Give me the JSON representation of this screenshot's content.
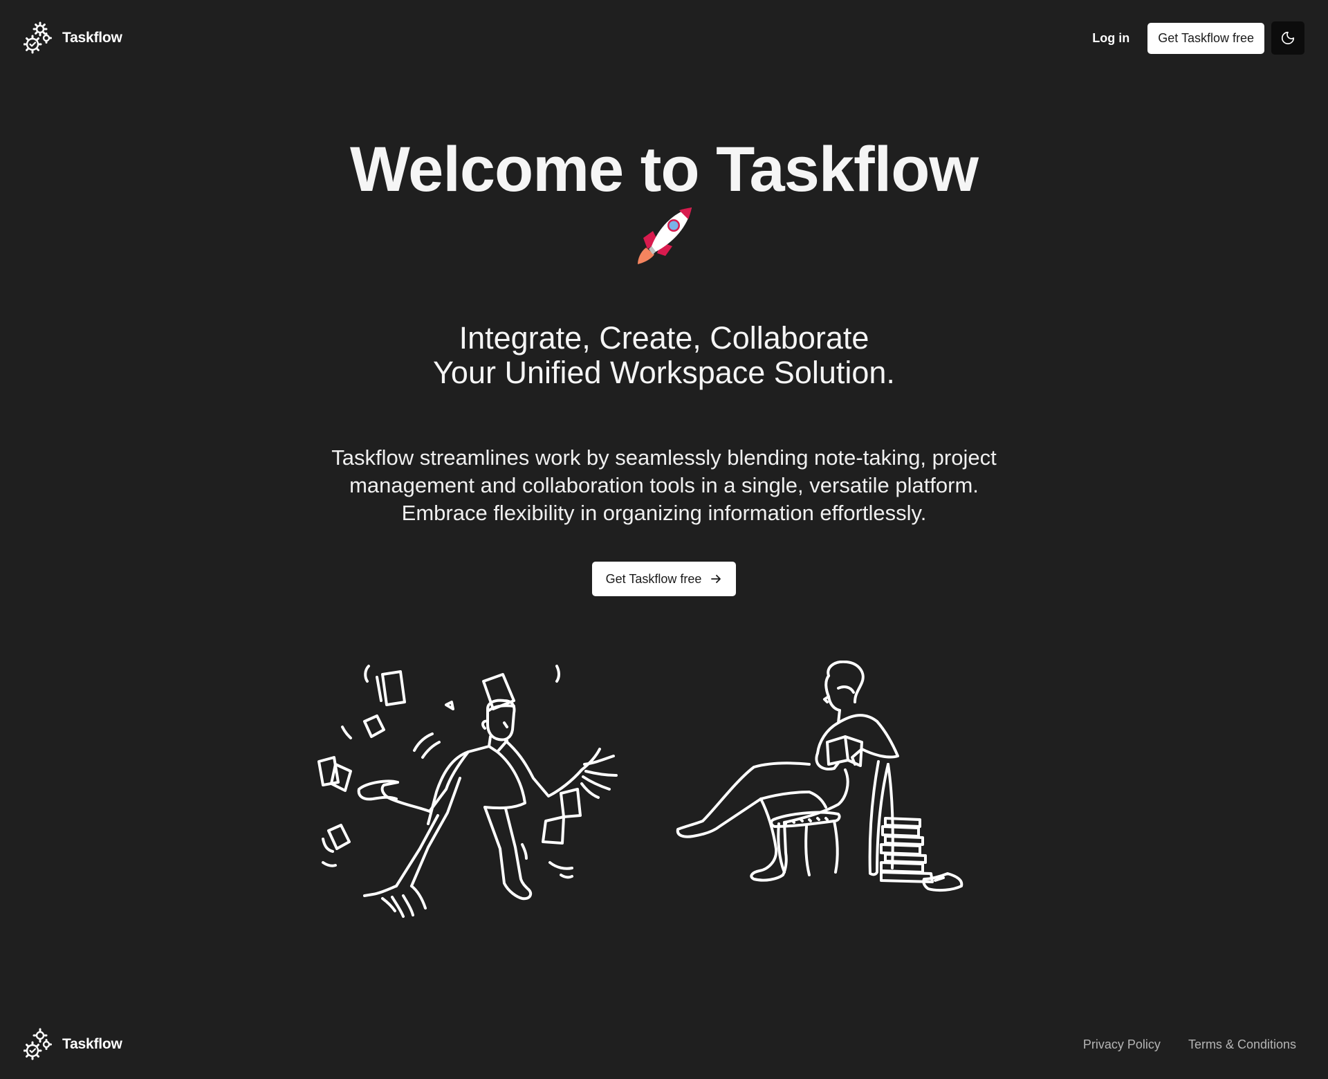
{
  "brand": {
    "name": "Taskflow",
    "logo_icon": "gears-check-icon"
  },
  "header": {
    "login_label": "Log in",
    "cta_label": "Get Taskflow free",
    "theme_toggle_icon": "moon-icon"
  },
  "hero": {
    "title": "Welcome to Taskflow",
    "emoji_icon": "rocket-icon",
    "tagline_line1": "Integrate, Create, Collaborate",
    "tagline_line2": "Your Unified Workspace Solution.",
    "description": "Taskflow streamlines work by seamlessly blending note-taking, project management and collaboration tools in a single, versatile platform. Embrace flexibility in organizing information effortlessly.",
    "cta_label": "Get Taskflow free",
    "cta_icon": "arrow-right-icon"
  },
  "illustrations": {
    "left": "juggling-papers-illustration",
    "right": "reading-person-illustration"
  },
  "footer": {
    "brand_name": "Taskflow",
    "links": [
      "Privacy Policy",
      "Terms & Conditions"
    ]
  },
  "colors": {
    "background": "#1f1f1f",
    "text": "#f5f5f5",
    "button_bg": "#ffffff",
    "button_text": "#1a1a1a",
    "toggle_bg": "#0c0c0c",
    "footer_link": "#b5b5b5"
  }
}
